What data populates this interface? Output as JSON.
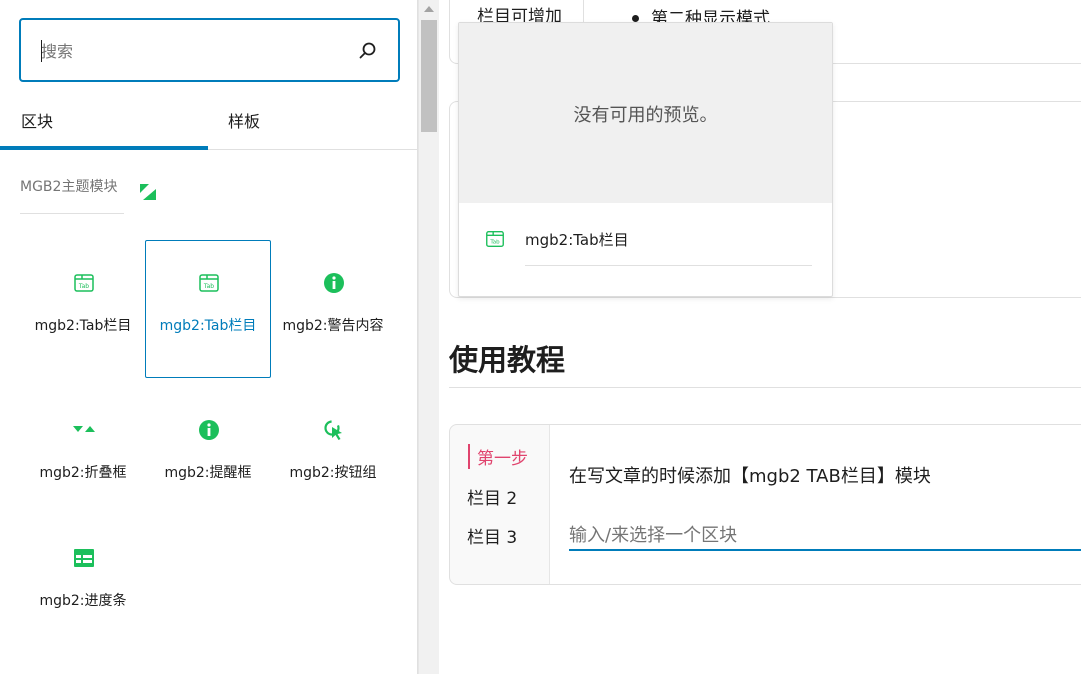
{
  "search": {
    "placeholder": "搜索"
  },
  "tabs": [
    {
      "label": "区块",
      "active": true
    },
    {
      "label": "样板",
      "active": false
    }
  ],
  "category": {
    "title": "MGB2主题模块"
  },
  "blocks": [
    {
      "label": "mgb2:Tab栏目",
      "icon": "tab-icon",
      "selected": false
    },
    {
      "label": "mgb2:Tab栏目",
      "icon": "tab-icon",
      "selected": true
    },
    {
      "label": "mgb2:警告内容",
      "icon": "info-icon",
      "selected": false
    },
    {
      "label": "mgb2:折叠框",
      "icon": "collapse-icon",
      "selected": false
    },
    {
      "label": "mgb2:提醒框",
      "icon": "info-icon",
      "selected": false
    },
    {
      "label": "mgb2:按钮组",
      "icon": "cursor-icon",
      "selected": false
    },
    {
      "label": "mgb2:进度条",
      "icon": "progress-icon",
      "selected": false
    }
  ],
  "editor": {
    "box1": {
      "left_text": "栏目可增加",
      "bullet_text": "第二种显示模式"
    },
    "heading": "使用教程",
    "steps": [
      "第一步",
      "栏目 2",
      "栏目 3"
    ],
    "content_text": "在写文章的时候添加【mgb2 TAB栏目】模块",
    "block_input_placeholder": "输入/来选择一个区块"
  },
  "preview": {
    "message": "没有可用的预览。",
    "title": "mgb2:Tab栏目"
  },
  "colors": {
    "accent": "#007cba",
    "green": "#1cbf5b",
    "pink": "#e0446e"
  }
}
